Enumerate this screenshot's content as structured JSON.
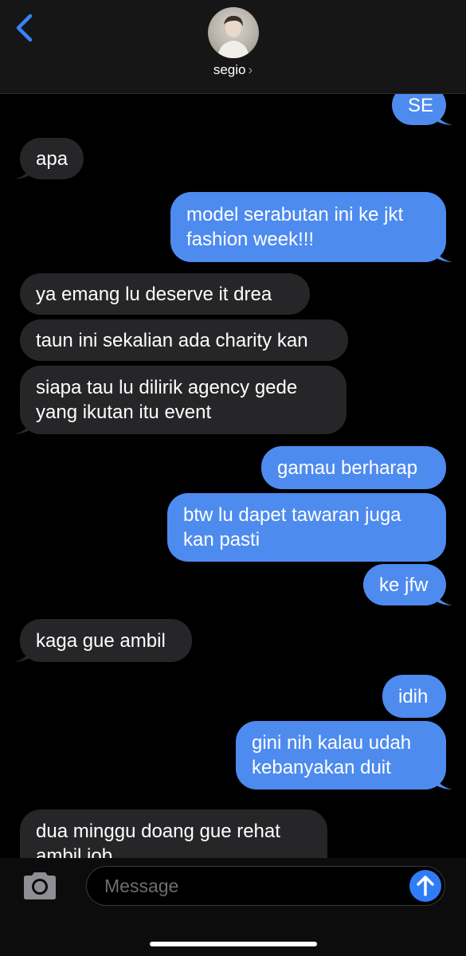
{
  "header": {
    "contact_name": "segio",
    "chevron": "›"
  },
  "messages": [
    {
      "from": "me",
      "text": "SE"
    },
    {
      "from": "them",
      "text": "apa"
    },
    {
      "from": "me",
      "text": "model serabutan ini ke jkt\nfashion week!!!"
    },
    {
      "from": "them",
      "text": "ya emang lu deserve it drea"
    },
    {
      "from": "them",
      "text": "taun ini sekalian ada charity kan"
    },
    {
      "from": "them",
      "text": "siapa tau lu dilirik agency gede\nyang ikutan itu event"
    },
    {
      "from": "me",
      "text": "gamau berharap"
    },
    {
      "from": "me",
      "text": "btw lu dapet tawaran juga\nkan pasti"
    },
    {
      "from": "me",
      "text": "ke jfw"
    },
    {
      "from": "them",
      "text": "kaga gue ambil"
    },
    {
      "from": "me",
      "text": "idih"
    },
    {
      "from": "me",
      "text": "gini nih kalau udah\nkebanyakan duit"
    },
    {
      "from": "them",
      "text": "dua minggu doang gue rehat\nambil job"
    }
  ],
  "composer": {
    "placeholder": "Message"
  },
  "icons": {
    "back": "chevron-left-icon",
    "camera": "camera-icon",
    "send": "arrow-up-icon"
  },
  "colors": {
    "outgoing_bubble": "#4e8bef",
    "incoming_bubble": "#262628",
    "accent": "#2f7cf6"
  }
}
